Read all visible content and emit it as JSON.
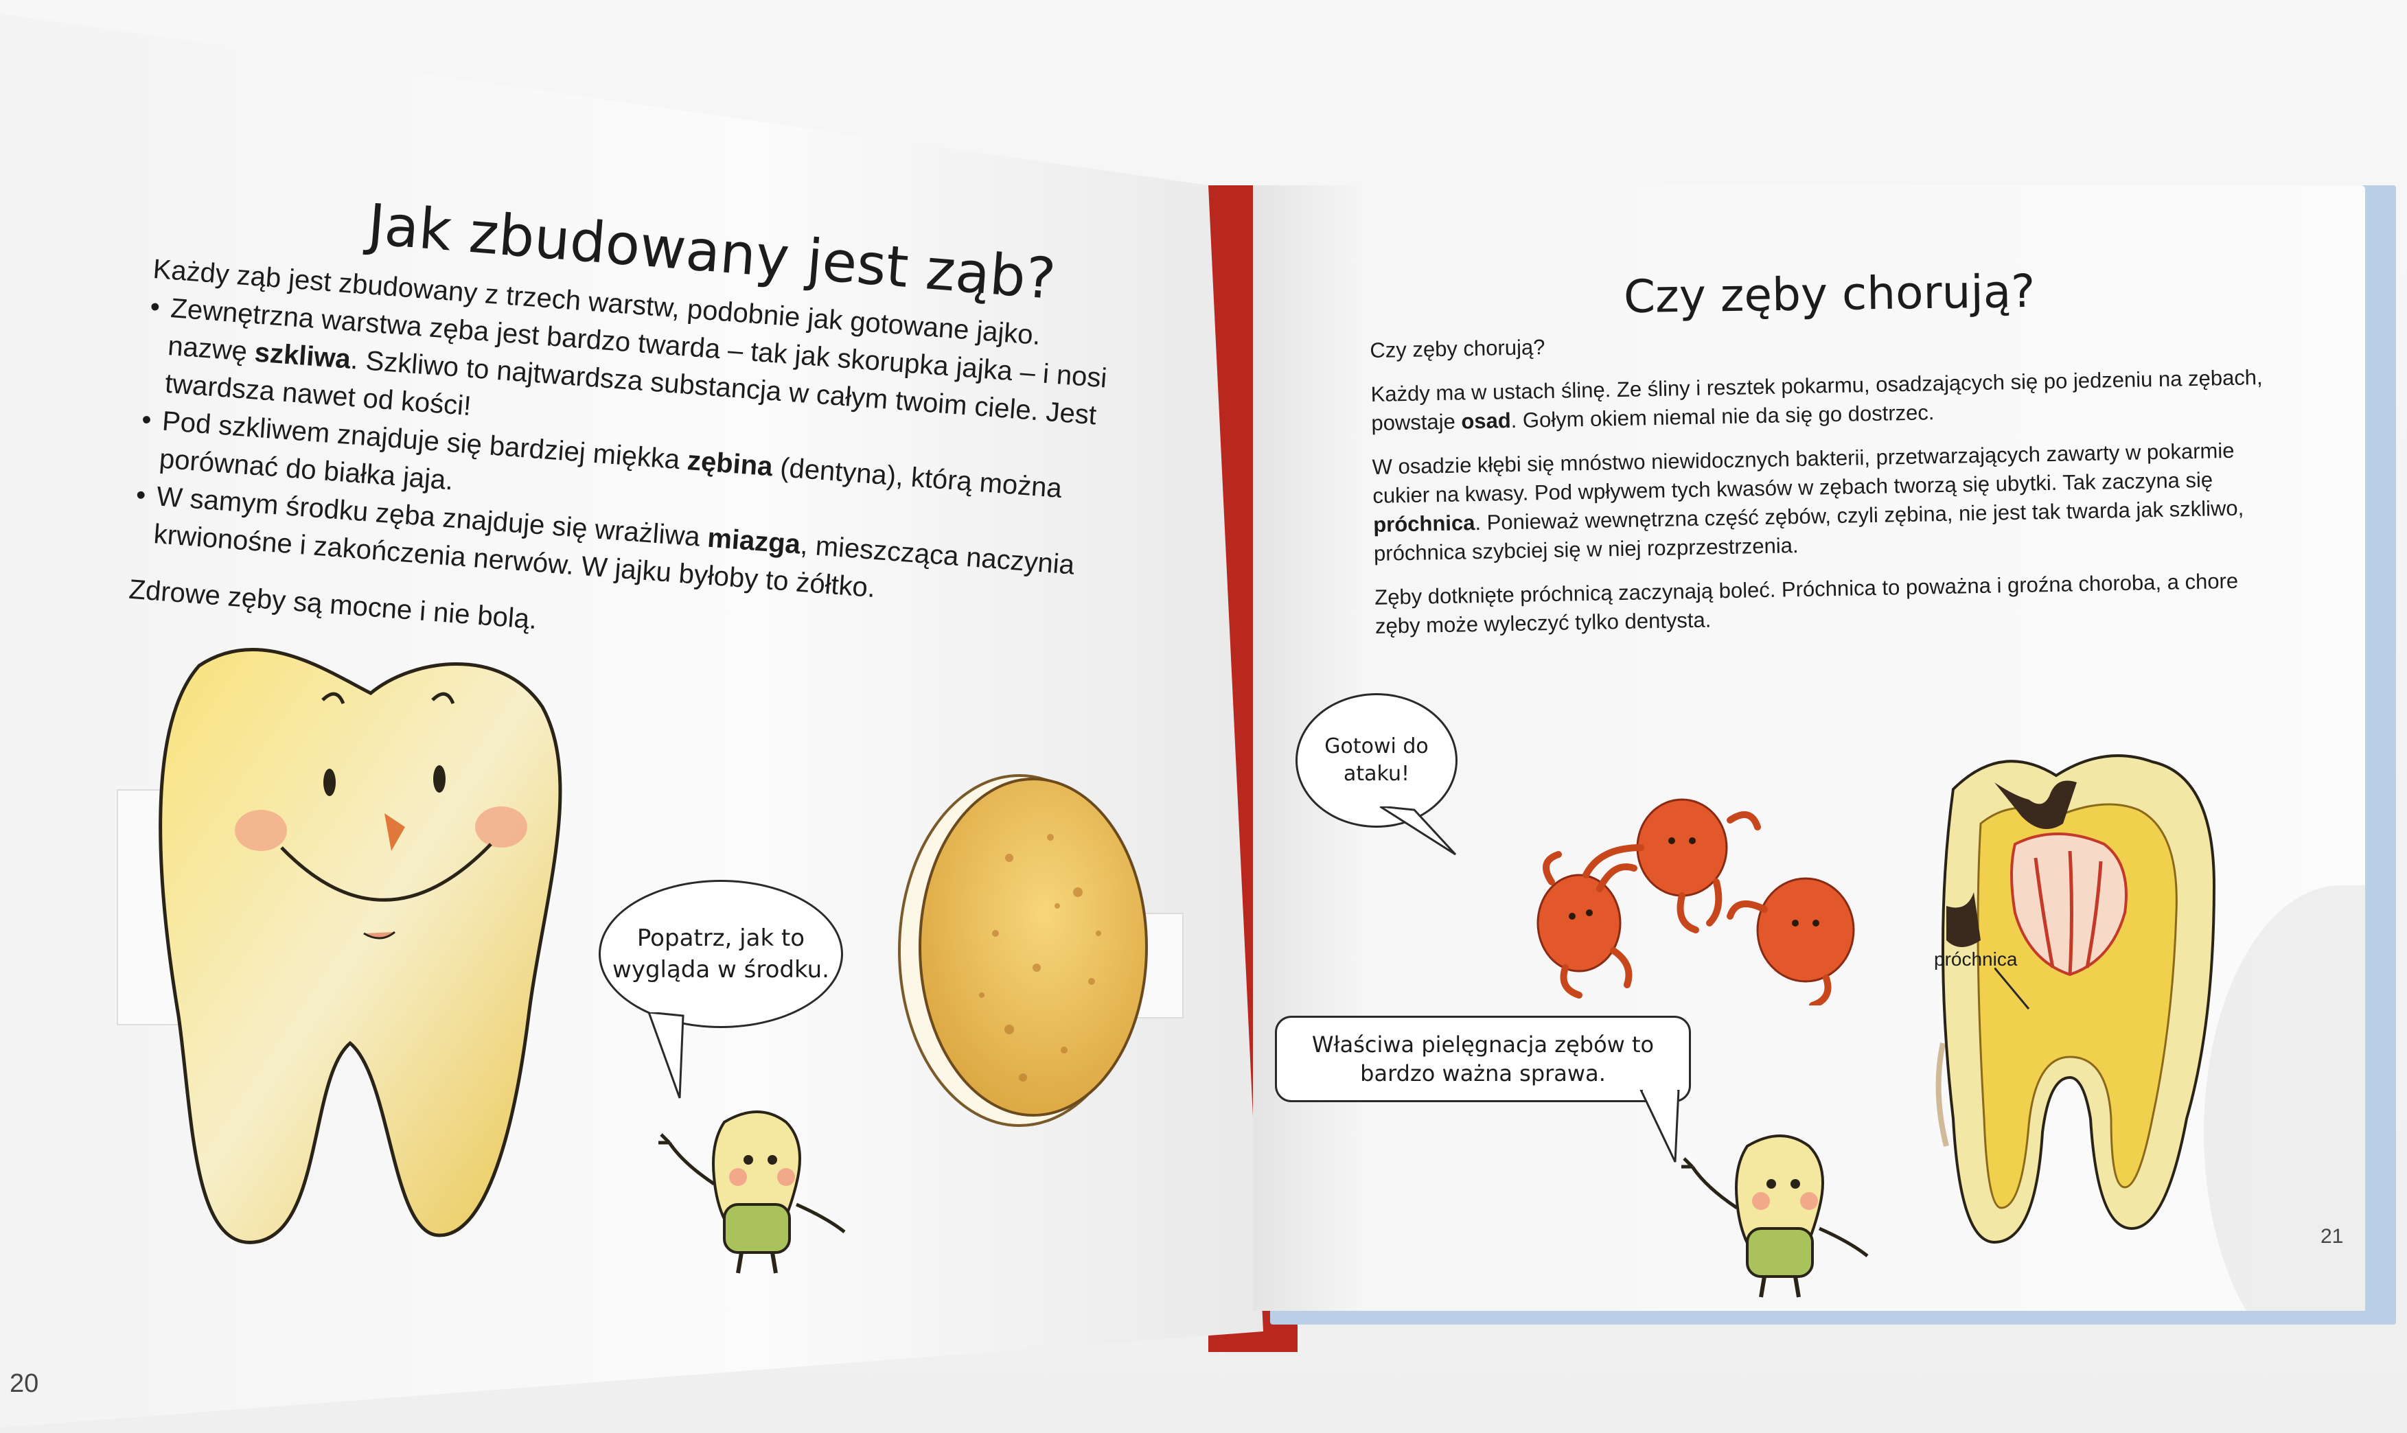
{
  "left_page": {
    "title": "Jak zbudowany jest ząb?",
    "intro": "Każdy ząb jest zbudowany z trzech warstw, podobnie jak gotowane jajko.",
    "bullets": [
      {
        "before": "Zewnętrzna warstwa zęba jest bardzo twarda – tak jak skorupka jajka – i nosi nazwę ",
        "bold": "szkliwa",
        "after": ". Szkliwo to najtwardsza substancja w całym twoim ciele. Jest twardsza nawet od kości!"
      },
      {
        "before": "Pod szkliwem znajduje się bardziej miękka ",
        "bold": "zębina",
        "after": " (dentyna), którą można porównać do białka jaja."
      },
      {
        "before": "W samym środku zęba znajduje się wrażliwa ",
        "bold": "miazga",
        "after": ", mieszcząca naczynia krwionośne i zakończenia nerwów. W jajku byłoby to żółtko."
      }
    ],
    "closing": "Zdrowe zęby są mocne i nie bolą.",
    "bubble_text": "Popatrz, jak to wygląda w środku.",
    "page_number": "20"
  },
  "right_page": {
    "title": "Czy zęby chorują?",
    "subtitle": "Czy zęby chorują?",
    "p1": {
      "before": "Każdy ma w ustach ślinę. Ze śliny i resztek pokarmu, osadzających się po jedzeniu na zębach, powstaje ",
      "bold": "osad",
      "after": ". Gołym okiem niemal nie da się go dostrzec."
    },
    "p2": {
      "before": "W osadzie kłębi się mnóstwo niewidocznych bakterii, przetwarzających zawarty w pokarmie cukier na kwasy. Pod wpływem tych kwasów w zębach tworzą się ubytki. Tak zaczyna się ",
      "bold": "próchnica",
      "after": ". Ponieważ wewnętrzna część zębów, czyli zębina, nie jest tak twarda jak szkliwo, próchnica szybciej się w niej rozprzestrzenia."
    },
    "p3": "Zęby dotknięte próchnicą zaczynają boleć. Próchnica to poważna i groźna choroba, a chore zęby może wyleczyć tylko dentysta.",
    "bubble_attack": "Gotowi do ataku!",
    "bubble_care": "Właściwa pielęgnacja zębów to bardzo ważna sprawa.",
    "label_decay": "próchnica",
    "page_number": "21"
  }
}
